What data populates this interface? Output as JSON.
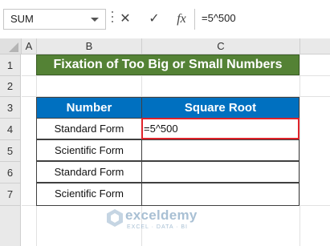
{
  "formula_bar": {
    "name_box": "SUM",
    "cancel_symbol": "✕",
    "enter_symbol": "✓",
    "function_symbol": "fx",
    "formula": "=5^500"
  },
  "grid": {
    "columns": [
      "A",
      "B",
      "C"
    ],
    "rows": [
      "1",
      "2",
      "3",
      "4",
      "5",
      "6",
      "7"
    ]
  },
  "sheet": {
    "title": "Fixation of Too Big or Small Numbers",
    "headers": [
      "Number",
      "Square Root"
    ],
    "rows": [
      {
        "number": "Standard Form",
        "root": "=5^500"
      },
      {
        "number": "Scientific Form",
        "root": ""
      },
      {
        "number": "Standard Form",
        "root": ""
      },
      {
        "number": "Scientific Form",
        "root": ""
      }
    ]
  },
  "watermark": {
    "name": "exceldemy",
    "tagline": "EXCEL · DATA · BI"
  },
  "colors": {
    "title_bg": "#548235",
    "header_bg": "#0070c0",
    "active_border": "#e0232a"
  }
}
